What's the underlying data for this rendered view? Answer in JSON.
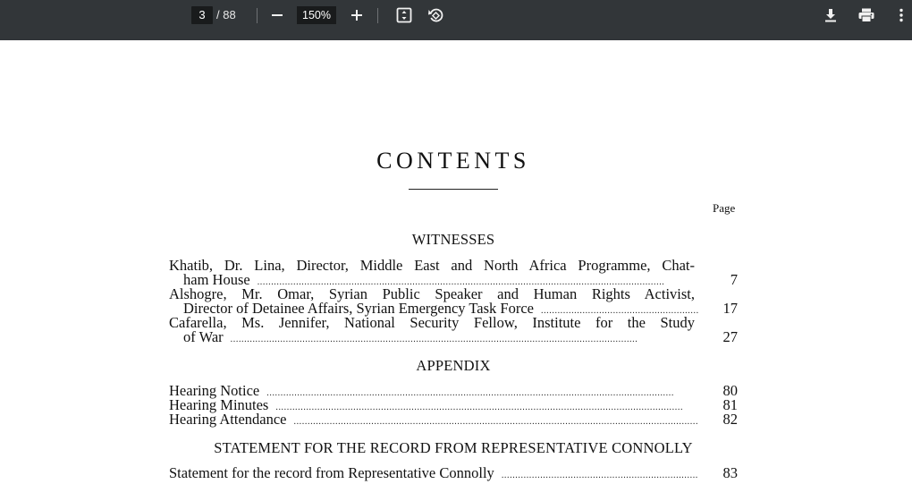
{
  "viewer": {
    "current_page": "3",
    "total_pages": "/ 88",
    "zoom": "150%",
    "icons": [
      "minus-icon",
      "plus-icon",
      "fit-page-icon",
      "rotate-icon",
      "download-icon",
      "print-icon",
      "more-vert-icon"
    ]
  },
  "document": {
    "title": "CONTENTS",
    "page_column_header": "Page",
    "sections": [
      {
        "heading": "WITNESSES",
        "entries": [
          {
            "line1": "Khatib, Dr. Lina, Director, Middle East and North Africa Programme, Chat-",
            "line2": "ham House",
            "page": "7"
          },
          {
            "line1": "Alshogre, Mr. Omar, Syrian Public Speaker and Human Rights Activist,",
            "line2": "Director of Detainee Affairs, Syrian Emergency Task Force",
            "page": "17"
          },
          {
            "line1": "Cafarella, Ms. Jennifer, National Security Fellow, Institute for the Study",
            "line2": "of War",
            "page": "27"
          }
        ]
      },
      {
        "heading": "APPENDIX",
        "entries": [
          {
            "text": "Hearing Notice",
            "page": "80"
          },
          {
            "text": "Hearing Minutes",
            "page": "81"
          },
          {
            "text": "Hearing Attendance",
            "page": "82"
          }
        ]
      },
      {
        "heading": "STATEMENT FOR THE RECORD FROM REPRESENTATIVE CONNOLLY",
        "entries": [
          {
            "text": "Statement for the record from Representative Connolly",
            "page": "83"
          }
        ]
      }
    ]
  }
}
